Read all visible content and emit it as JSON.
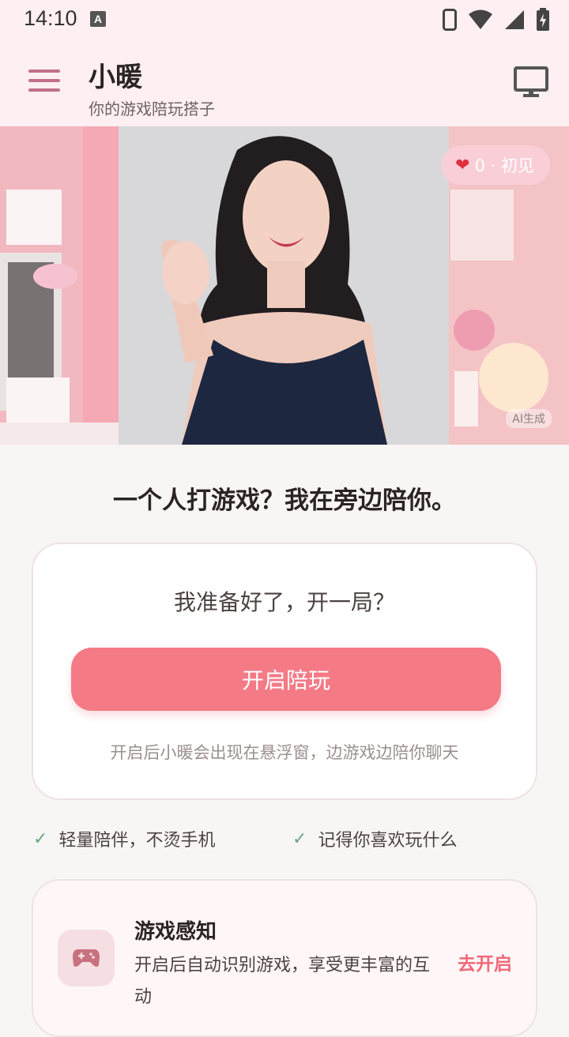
{
  "status_bar": {
    "time": "14:10",
    "keyboard_indicator": "A",
    "icons": [
      "phone-icon",
      "wifi-icon",
      "signal-icon",
      "battery-charging-icon"
    ]
  },
  "app_bar": {
    "title": "小暖",
    "subtitle": "你的游戏陪玩搭子"
  },
  "hero": {
    "badge_heart": "❤",
    "badge_text": "0 · 初见",
    "ai_label": "AI生成"
  },
  "headline": "一个人打游戏？我在旁边陪你。",
  "start_card": {
    "question": "我准备好了，开一局？",
    "button_label": "开启陪玩",
    "note": "开启后小暖会出现在悬浮窗，边游戏边陪你聊天"
  },
  "features": [
    {
      "icon": "✓",
      "label": "轻量陪伴，不烫手机"
    },
    {
      "icon": "✓",
      "label": "记得你喜欢玩什么"
    }
  ],
  "game_card": {
    "title": "游戏感知",
    "description": "开启后自动识别游戏，享受更丰富的互动",
    "action": "去开启"
  },
  "colors": {
    "accent": "#f47a86",
    "appbar_bg": "#fdeff2",
    "page_bg": "#f8f6f5",
    "check": "#6aa880",
    "link": "#f0697a"
  }
}
